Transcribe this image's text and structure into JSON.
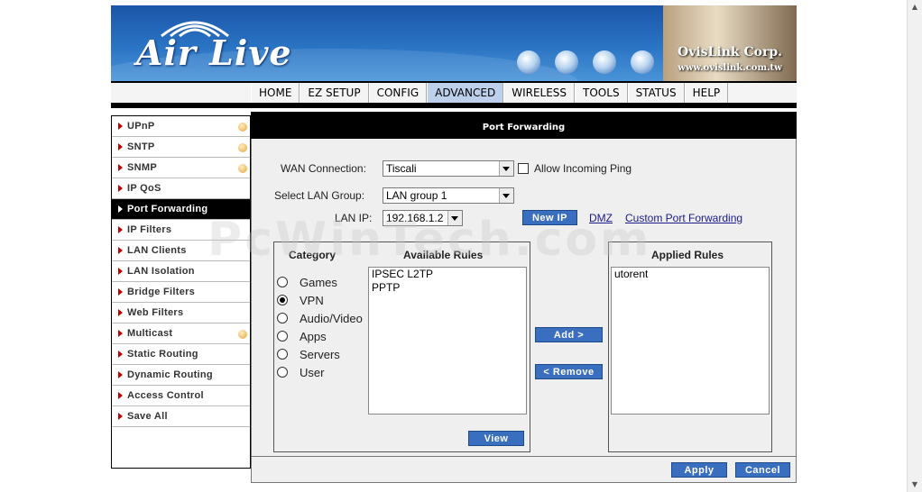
{
  "banner": {
    "logo": "Air Live",
    "corp_name": "OvisLink Corp.",
    "corp_url": "www.ovislink.com.tw"
  },
  "nav": {
    "items": [
      "HOME",
      "EZ SETUP",
      "CONFIG",
      "ADVANCED",
      "WIRELESS",
      "TOOLS",
      "STATUS",
      "HELP"
    ],
    "active": "ADVANCED"
  },
  "sidebar": {
    "items": [
      {
        "label": "UPnP",
        "dot": true
      },
      {
        "label": "SNTP",
        "dot": true
      },
      {
        "label": "SNMP",
        "dot": true
      },
      {
        "label": "IP QoS",
        "dot": false
      },
      {
        "label": "Port Forwarding",
        "dot": false,
        "active": true
      },
      {
        "label": "IP Filters",
        "dot": false
      },
      {
        "label": "LAN Clients",
        "dot": false
      },
      {
        "label": "LAN Isolation",
        "dot": false
      },
      {
        "label": "Bridge Filters",
        "dot": false
      },
      {
        "label": "Web Filters",
        "dot": false
      },
      {
        "label": "Multicast",
        "dot": true
      },
      {
        "label": "Static Routing",
        "dot": false
      },
      {
        "label": "Dynamic Routing",
        "dot": false
      },
      {
        "label": "Access Control",
        "dot": false
      },
      {
        "label": "Save All",
        "dot": false
      }
    ]
  },
  "page": {
    "title": "Port Forwarding",
    "wan_label": "WAN Connection:",
    "wan_value": "Tiscali",
    "allow_ping_label": "Allow Incoming Ping",
    "lan_group_label": "Select LAN Group:",
    "lan_group_value": "LAN group 1",
    "lan_ip_label": "LAN IP:",
    "lan_ip_value": "192.168.1.2",
    "new_ip_button": "New IP",
    "dmz_link": "DMZ",
    "custom_link": "Custom Port Forwarding",
    "category_title": "Category",
    "categories": [
      "Games",
      "VPN",
      "Audio/Video",
      "Apps",
      "Servers",
      "User"
    ],
    "selected_category": "VPN",
    "available_title": "Available Rules",
    "available_rules": [
      "IPSEC L2TP",
      "PPTP"
    ],
    "view_button": "View",
    "add_button": "Add >",
    "remove_button": "< Remove",
    "applied_title": "Applied Rules",
    "applied_rules": [
      "utorent"
    ],
    "apply_button": "Apply",
    "cancel_button": "Cancel"
  },
  "watermark": "PcWinTech.com"
}
